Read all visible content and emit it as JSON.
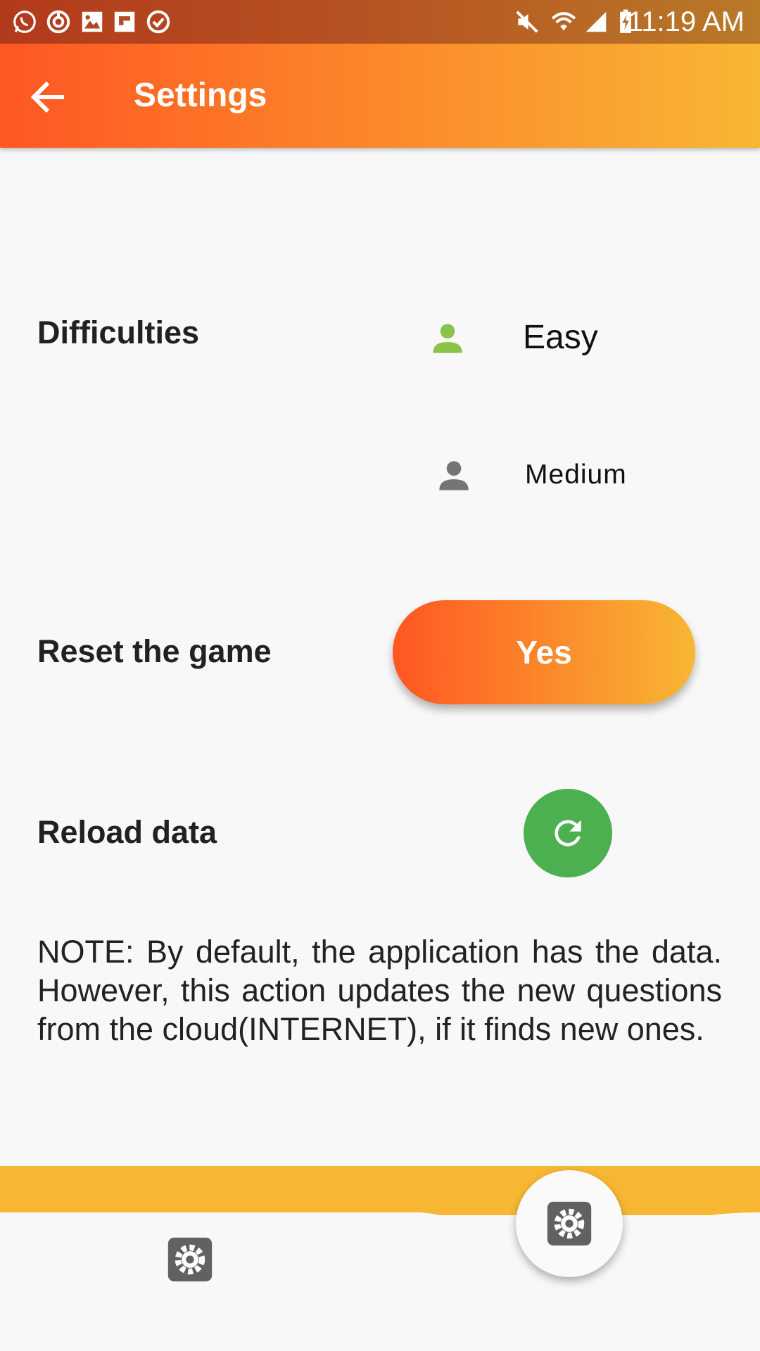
{
  "status_bar": {
    "time": "11:19 AM",
    "left_icons": [
      "whatsapp-icon",
      "sync-icon",
      "image-icon",
      "flipboard-icon",
      "check-circle-icon"
    ],
    "right_icons": [
      "mute-icon",
      "wifi-icon",
      "signal-icon",
      "battery-charging-icon"
    ]
  },
  "app_bar": {
    "title": "Settings",
    "back_icon": "arrow-back-icon"
  },
  "settings": {
    "difficulties_label": "Difficulties",
    "difficulties": [
      {
        "label": "Easy",
        "icon": "person-icon",
        "color": "#8bc34a",
        "selected": true
      },
      {
        "label": "Medium",
        "icon": "person-icon",
        "color": "#757575",
        "selected": false
      }
    ],
    "reset_label": "Reset the game",
    "reset_button": "Yes",
    "reload_label": "Reload data",
    "reload_icon": "refresh-icon",
    "note": "NOTE: By default, the application has the data. However, this action updates the new questions from the cloud(INTERNET), if it finds new ones."
  },
  "bottom_nav": {
    "left_icon": "gear-icon",
    "fab_icon": "gear-icon",
    "accent_color": "#f7b733"
  },
  "colors": {
    "primary_start": "#ff5722",
    "primary_end": "#f8b734",
    "reload": "#4caf50"
  }
}
